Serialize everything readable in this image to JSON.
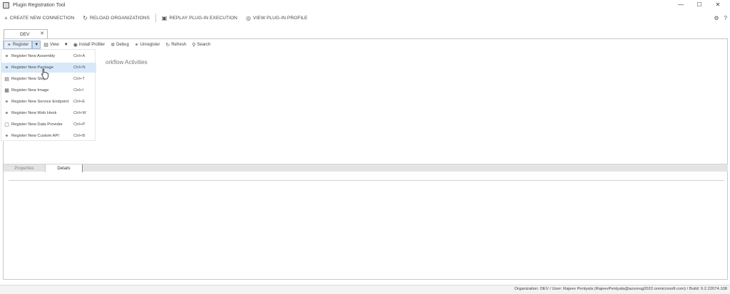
{
  "window": {
    "title": "Plugin Registration Tool",
    "controls": {
      "minimize": "—",
      "maximize": "☐",
      "close": "✕"
    }
  },
  "toolbar": {
    "create_connection": "CREATE NEW CONNECTION",
    "reload_organizations": "RELOAD ORGANIZATIONS",
    "replay_plugin": "REPLAY PLUG-IN EXECUTION",
    "view_plugin_profile": "VIEW PLUG-IN PROFILE",
    "icons": {
      "create": "+",
      "reload": "↻",
      "replay": "▣",
      "profile": "◎",
      "settings": "⚙",
      "help": "?"
    }
  },
  "connection_tab": {
    "label": "DEV",
    "close": "✕"
  },
  "subtoolbar": {
    "register": "Register",
    "view": "View",
    "install_profiler": "Install Profiler",
    "debug": "Debug",
    "unregister": "Unregister",
    "refresh": "Refresh",
    "search": "Search",
    "dropdown_arrow": "▼"
  },
  "background_label": "orkflow Activities",
  "register_menu": {
    "items": [
      {
        "label": "Register New Assembly",
        "shortcut": "Ctrl+A",
        "icon": "⚭"
      },
      {
        "label": "Register New Package",
        "shortcut": "Ctrl+N",
        "icon": "⚭"
      },
      {
        "label": "Register New Step",
        "shortcut": "Ctrl+T",
        "icon": "▤"
      },
      {
        "label": "Register New Image",
        "shortcut": "Ctrl+I",
        "icon": "▦"
      },
      {
        "label": "Register New Service Endpoint",
        "shortcut": "Ctrl+E",
        "icon": "⚭"
      },
      {
        "label": "Register New Web Hook",
        "shortcut": "Ctrl+W",
        "icon": "⚭"
      },
      {
        "label": "Register New Data Provider",
        "shortcut": "Ctrl+P",
        "icon": "▢"
      },
      {
        "label": "Register New Custom API",
        "shortcut": "Ctrl+B",
        "icon": "⚭"
      }
    ],
    "hovered_index": 1
  },
  "bottom_panel": {
    "tab_properties": "Properties",
    "tab_details": "Details"
  },
  "status_bar": {
    "text": "Organization: DEV / User: Rajeev Pentyala (RajeevPentyala@azureug2022.onmicrosoft.com) / Build: 9.2.22074.108"
  },
  "colors": {
    "menu_hover": "#d7e9f9",
    "active_button": "#e6f0fa"
  }
}
